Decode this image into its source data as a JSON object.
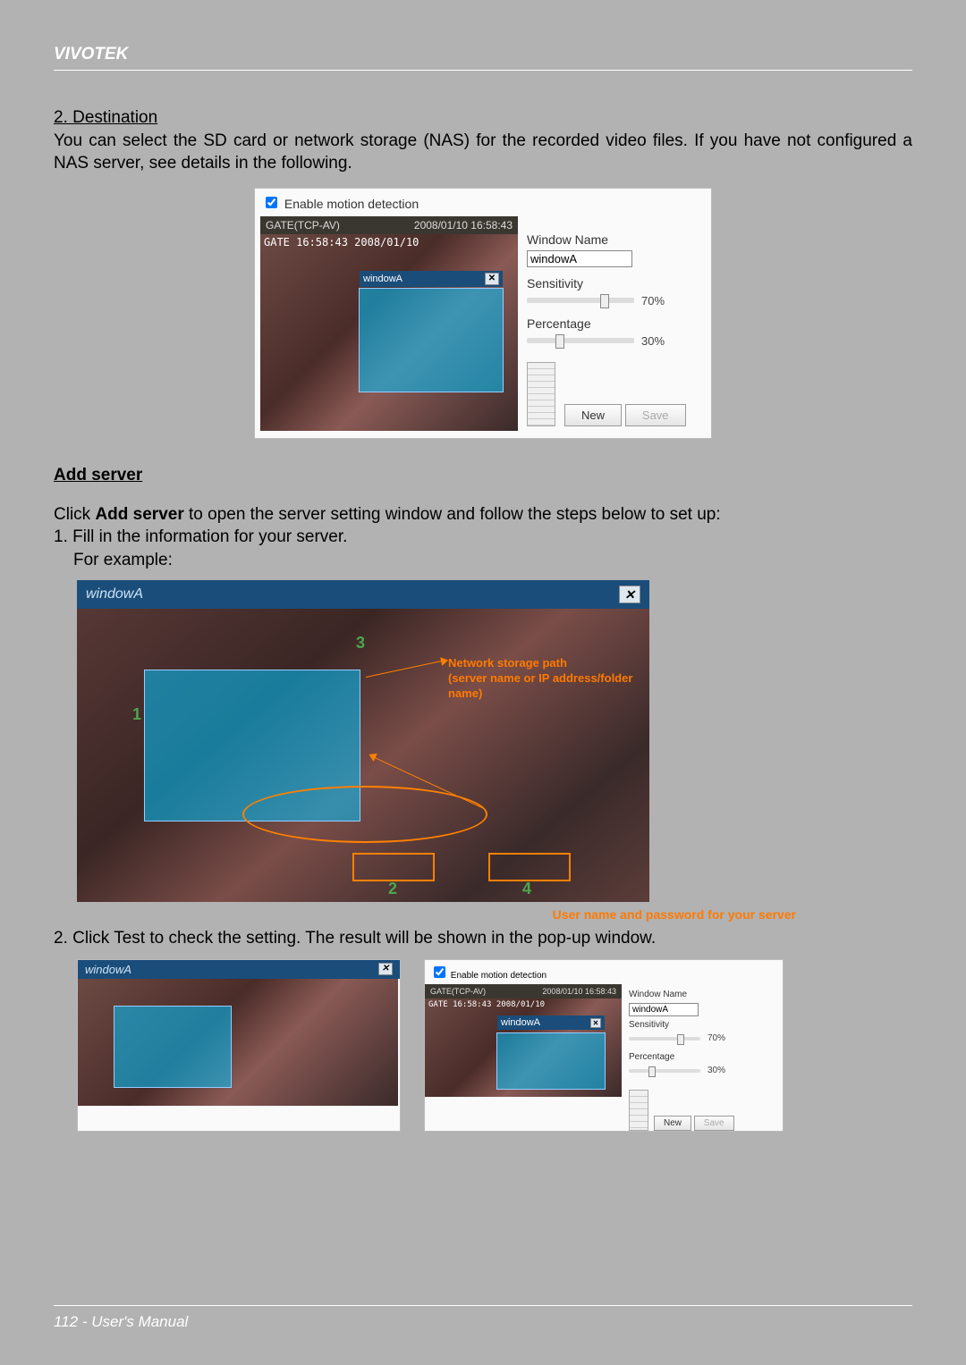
{
  "header": {
    "brand": "VIVOTEK"
  },
  "sec": {
    "heading": "2. Destination",
    "para1": "You can select the SD card or network storage (NAS) for the recorded video files. If you have not configured a NAS server, see details in the following.",
    "add_server_heading": "Add server",
    "click_pre": "Click ",
    "click_bold": "Add server",
    "click_post": " to open the server setting window and follow the steps below to set up:",
    "step1a": "1. Fill in the information for your server.",
    "step1b": "For example:",
    "step2": "2. Click Test to check the setting. The result will be shown in the pop-up window."
  },
  "motion": {
    "enable_label": "Enable motion detection",
    "stream_title": "GATE(TCP-AV)",
    "timestamp": "2008/01/10 16:58:43",
    "overlay_text": "GATE 16:58:43 2008/01/10",
    "window_box_label": "windowA",
    "window_name_label": "Window Name",
    "window_name_value": "windowA",
    "sensitivity_label": "Sensitivity",
    "sensitivity_value": "70%",
    "percentage_label": "Percentage",
    "percentage_value": "30%",
    "new_btn": "New",
    "save_btn": "Save"
  },
  "fig2": {
    "title": "windowA",
    "n1": "1",
    "n2": "2",
    "n3": "3",
    "n4": "4",
    "label_top1": "Network storage path",
    "label_top2": "(server name or IP address/folder name)",
    "caption_right": "User name and password for your server"
  },
  "footer": {
    "text": "112 - User's Manual"
  }
}
